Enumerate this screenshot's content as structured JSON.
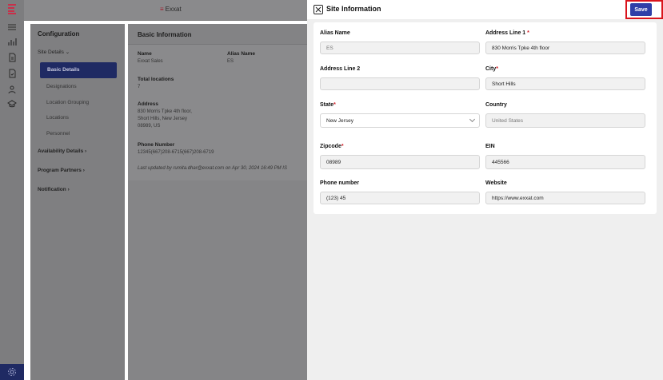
{
  "app": {
    "brand": "Exxat"
  },
  "nav": {
    "heading": "Configuration",
    "site_details": "Site Details",
    "sub_items": [
      "Basic Details",
      "Designations",
      "Location Grouping",
      "Locations",
      "Personnel"
    ],
    "availability": "Availability Details",
    "program_partners": "Program Partners",
    "notification": "Notification"
  },
  "basic_info": {
    "header": "Basic Information",
    "name_label": "Name",
    "name_value": "Exxat Sales",
    "alias_label": "Alias Name",
    "alias_value": "ES",
    "total_label": "Total locations",
    "total_value": "7",
    "address_label": "Address",
    "address_line1": "830 Morris Tpke 4th floor,",
    "address_line2": "Short Hills, New Jersey",
    "address_line3": "08989, US",
    "phone_label": "Phone Number",
    "phone_value": "12345(667)208-6715(667)208-6719",
    "last_updated": "Last updated by rumita.dhar@exxat.com on Apr 30, 2024 16:49 PM IS"
  },
  "drawer": {
    "title": "Site Information",
    "save_label": "Save",
    "fields": {
      "alias_name": {
        "label": "Alias Name",
        "value": "ES"
      },
      "address_line1": {
        "label": "Address Line 1",
        "value": "830 Morris Tpke 4th floor"
      },
      "address_line2": {
        "label": "Address Line 2",
        "value": ""
      },
      "city": {
        "label": "City",
        "value": "Short Hills"
      },
      "state": {
        "label": "State",
        "value": "New Jersey"
      },
      "country": {
        "label": "Country",
        "value": "United States"
      },
      "zipcode": {
        "label": "Zipcode",
        "value": "08989"
      },
      "ein": {
        "label": "EIN",
        "value": "445566"
      },
      "phone": {
        "label": "Phone number",
        "value": "(123) 45"
      },
      "website": {
        "label": "Website",
        "value": "https://www.exxat.com"
      }
    },
    "required_mark": "*"
  },
  "colors": {
    "primary": "#2f3fa8",
    "navy": "#1f2a63",
    "required": "#d21c24",
    "highlight": "#d9141c"
  }
}
